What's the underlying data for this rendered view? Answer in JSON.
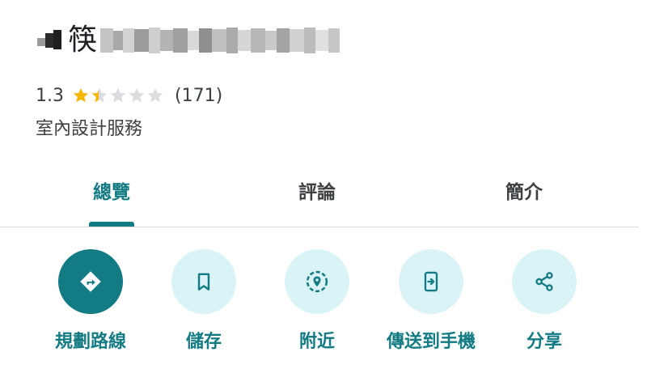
{
  "place": {
    "title_visible_char": "筷",
    "rating": "1.3",
    "rating_value": 1.3,
    "review_count": "(171)",
    "category": "室內設計服務"
  },
  "tabs": [
    {
      "label": "總覽",
      "active": true
    },
    {
      "label": "評論",
      "active": false
    },
    {
      "label": "簡介",
      "active": false
    }
  ],
  "actions": [
    {
      "label": "規劃路線",
      "icon": "directions-icon"
    },
    {
      "label": "儲存",
      "icon": "bookmark-icon"
    },
    {
      "label": "附近",
      "icon": "nearby-icon"
    },
    {
      "label": "傳送到手機",
      "icon": "send-to-phone-icon"
    },
    {
      "label": "分享",
      "icon": "share-icon"
    }
  ],
  "colors": {
    "accent": "#137b83",
    "accent_light": "#d9f3f6",
    "star_filled": "#f6b704",
    "star_empty": "#dadce0"
  }
}
